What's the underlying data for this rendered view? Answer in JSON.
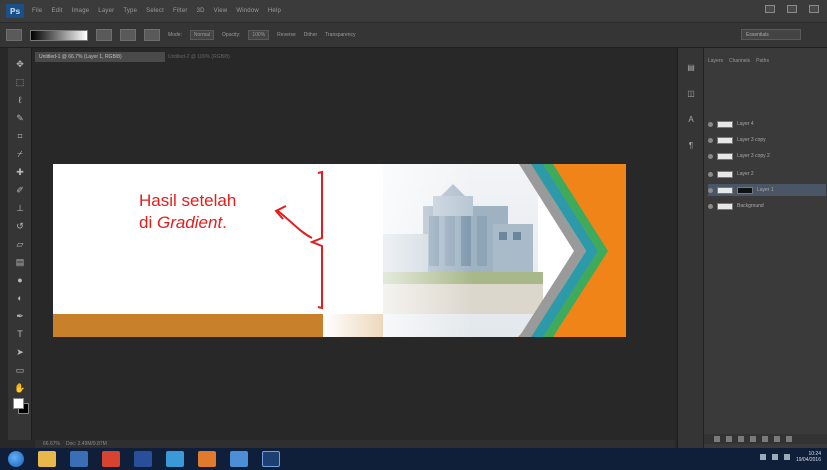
{
  "menubar": {
    "logo": "Ps",
    "items": [
      "File",
      "Edit",
      "Image",
      "Layer",
      "Type",
      "Select",
      "Filter",
      "3D",
      "View",
      "Window",
      "Help"
    ]
  },
  "options": {
    "mode_label": "Mode:",
    "mode_value": "Normal",
    "opacity_label": "Opacity:",
    "opacity_value": "100%",
    "reverse_label": "Reverse",
    "dither_label": "Dither",
    "transparency_label": "Transparency",
    "workspace": "Essentials"
  },
  "document": {
    "active_tab": "Untitled-1 @ 66.7% (Layer 1, RGB/8)",
    "inactive_tab": "Untitled-2 @ 100% (RGB/8)",
    "status_zoom": "66.67%",
    "status_doc": "Doc: 2.49M/9.87M"
  },
  "panels": {
    "tabs": [
      "Layers",
      "Channels",
      "Paths"
    ],
    "layers": [
      {
        "name": "Layer 4"
      },
      {
        "name": "Layer 3 copy"
      },
      {
        "name": "Layer 3 copy 2"
      },
      {
        "name": "Layer 2"
      },
      {
        "name": "Layer 1"
      },
      {
        "name": "Background"
      }
    ]
  },
  "annotation": {
    "line1": "Hasil setelah",
    "line2_prefix": "di ",
    "line2_italic": "Gradient",
    "line2_suffix": "."
  },
  "taskbar": {
    "time": "10:24",
    "date": "19/04/2016"
  },
  "colors": {
    "annotation_red": "#e41c1c",
    "banner_orange": "#f08418",
    "stripe_green": "#3daa5c",
    "stripe_teal": "#2c9aa8",
    "bottom_band": "#c8812a"
  }
}
